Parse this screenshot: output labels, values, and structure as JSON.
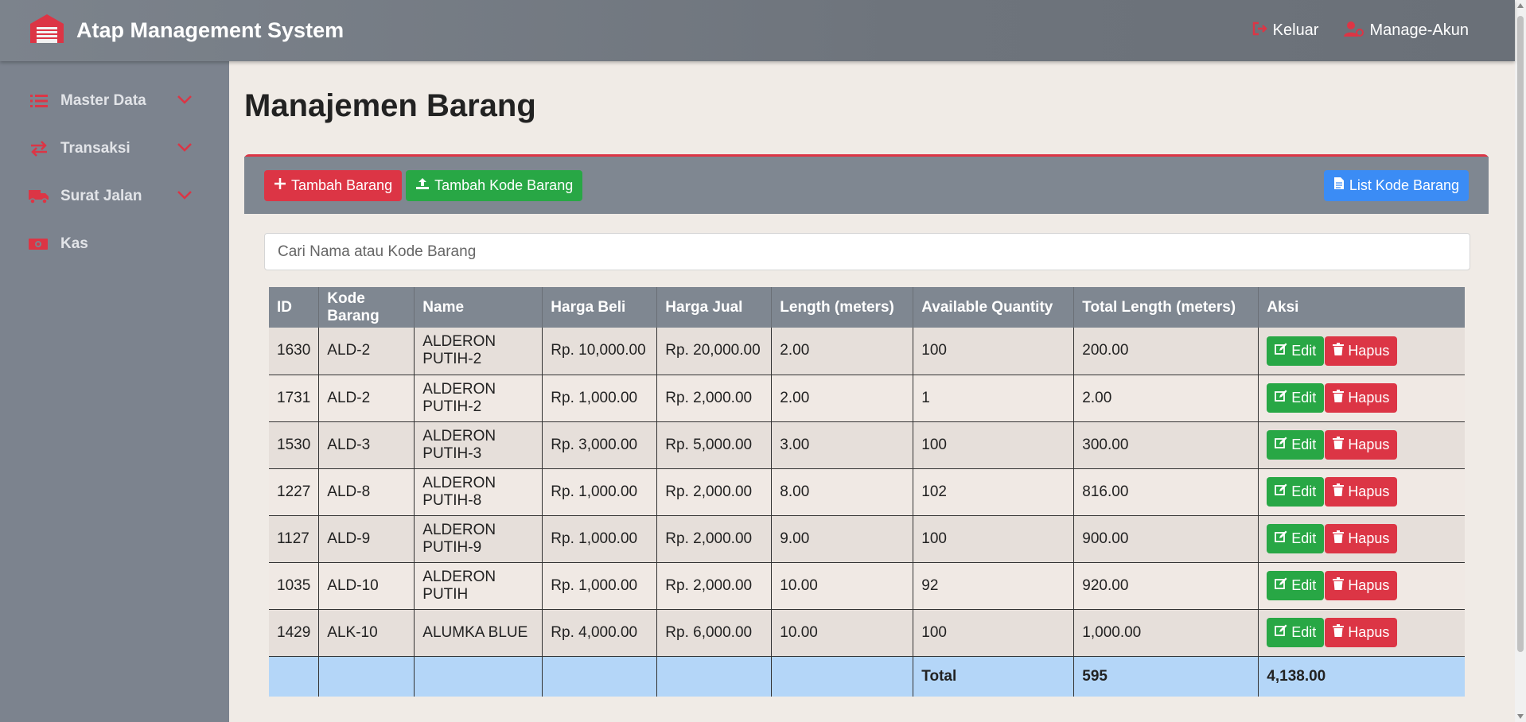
{
  "app": {
    "title": "Atap Management System"
  },
  "nav": {
    "logout": "Keluar",
    "manage_account": "Manage-Akun"
  },
  "sidebar": {
    "items": [
      {
        "label": "Master Data",
        "icon": "list-icon"
      },
      {
        "label": "Transaksi",
        "icon": "exchange-icon"
      },
      {
        "label": "Surat Jalan",
        "icon": "truck-icon"
      },
      {
        "label": "Kas",
        "icon": "money-icon"
      }
    ]
  },
  "page": {
    "title": "Manajemen Barang"
  },
  "toolbar": {
    "add_item": "Tambah Barang",
    "add_code": "Tambah Kode Barang",
    "list_code": "List Kode Barang"
  },
  "search": {
    "placeholder": "Cari Nama atau Kode Barang",
    "value": ""
  },
  "table": {
    "headers": [
      "ID",
      "Kode Barang",
      "Name",
      "Harga Beli",
      "Harga Jual",
      "Length (meters)",
      "Available Quantity",
      "Total Length (meters)",
      "Aksi"
    ],
    "rows": [
      [
        "1630",
        "ALD-2",
        "ALDERON PUTIH-2",
        "Rp. 10,000.00",
        "Rp. 20,000.00",
        "2.00",
        "100",
        "200.00"
      ],
      [
        "1731",
        "ALD-2",
        "ALDERON PUTIH-2",
        "Rp. 1,000.00",
        "Rp. 2,000.00",
        "2.00",
        "1",
        "2.00"
      ],
      [
        "1530",
        "ALD-3",
        "ALDERON PUTIH-3",
        "Rp. 3,000.00",
        "Rp. 5,000.00",
        "3.00",
        "100",
        "300.00"
      ],
      [
        "1227",
        "ALD-8",
        "ALDERON PUTIH-8",
        "Rp. 1,000.00",
        "Rp. 2,000.00",
        "8.00",
        "102",
        "816.00"
      ],
      [
        "1127",
        "ALD-9",
        "ALDERON PUTIH-9",
        "Rp. 1,000.00",
        "Rp. 2,000.00",
        "9.00",
        "100",
        "900.00"
      ],
      [
        "1035",
        "ALD-10",
        "ALDERON PUTIH",
        "Rp. 1,000.00",
        "Rp. 2,000.00",
        "10.00",
        "92",
        "920.00"
      ],
      [
        "1429",
        "ALK-10",
        "ALUMKA BLUE",
        "Rp. 4,000.00",
        "Rp. 6,000.00",
        "10.00",
        "100",
        "1,000.00"
      ]
    ],
    "edit_label": "Edit",
    "delete_label": "Hapus",
    "total": {
      "label": "Total",
      "quantity": "595",
      "length": "4,138.00"
    }
  },
  "colors": {
    "accent_red": "#dc3545",
    "accent_green": "#28a745",
    "accent_blue": "#3b8cf5",
    "header_gray": "#7f8791",
    "total_row": "#b4d6f8"
  }
}
